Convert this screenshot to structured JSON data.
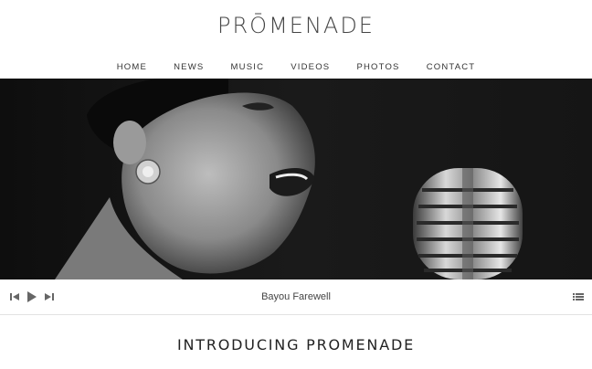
{
  "site": {
    "logo": "PRŌMENADE"
  },
  "nav": {
    "items": [
      {
        "label": "HOME"
      },
      {
        "label": "NEWS"
      },
      {
        "label": "MUSIC"
      },
      {
        "label": "VIDEOS"
      },
      {
        "label": "PHOTOS"
      },
      {
        "label": "CONTACT"
      }
    ]
  },
  "hero": {
    "image": "black-and-white photo of a singer at a vintage microphone"
  },
  "player": {
    "track_title": "Bayou Farewell",
    "icons": [
      "previous-track-icon",
      "play-icon",
      "next-track-icon",
      "playlist-icon"
    ]
  },
  "main": {
    "heading": "INTRODUCING PROMENADE"
  }
}
